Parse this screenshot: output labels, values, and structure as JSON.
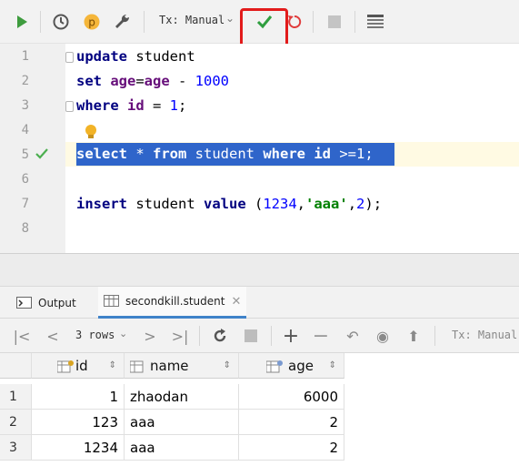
{
  "toolbar": {
    "tx_label": "Tx: Manual",
    "buttons": [
      "execute",
      "history",
      "profile",
      "settings",
      "commit",
      "rollback",
      "stop",
      "output-layout"
    ]
  },
  "editor": {
    "line_numbers": [
      "1",
      "2",
      "3",
      "4",
      "5",
      "6",
      "7",
      "8"
    ],
    "lines": [
      [
        {
          "t": "update",
          "c": "kw"
        },
        {
          "t": " student",
          "c": ""
        }
      ],
      [
        {
          "t": "set ",
          "c": "kw"
        },
        {
          "t": "age",
          "c": "col"
        },
        {
          "t": "=",
          "c": ""
        },
        {
          "t": "age",
          "c": "col"
        },
        {
          "t": " - ",
          "c": ""
        },
        {
          "t": "1000",
          "c": "num"
        }
      ],
      [
        {
          "t": "where ",
          "c": "kw"
        },
        {
          "t": "id",
          "c": "col"
        },
        {
          "t": " = ",
          "c": ""
        },
        {
          "t": "1",
          "c": "num"
        },
        {
          "t": ";",
          "c": ""
        }
      ],
      [],
      [
        {
          "t": "select",
          "c": "k"
        },
        {
          "t": " * ",
          "c": ""
        },
        {
          "t": "from",
          "c": "k"
        },
        {
          "t": " student ",
          "c": ""
        },
        {
          "t": "where",
          "c": "k"
        },
        {
          "t": " ",
          "c": ""
        },
        {
          "t": "id",
          "c": "k"
        },
        {
          "t": " >=1;",
          "c": ""
        }
      ],
      [],
      [
        {
          "t": "insert",
          "c": "kw"
        },
        {
          "t": " student ",
          "c": ""
        },
        {
          "t": "value",
          "c": "kw"
        },
        {
          "t": " (",
          "c": ""
        },
        {
          "t": "1234",
          "c": "num"
        },
        {
          "t": ",",
          "c": ""
        },
        {
          "t": "'aaa'",
          "c": "str"
        },
        {
          "t": ",",
          "c": ""
        },
        {
          "t": "2",
          "c": "num"
        },
        {
          "t": ");",
          "c": ""
        }
      ],
      []
    ],
    "selected_line": 5
  },
  "result_tabs": {
    "output_label": "Output",
    "table_label": "secondkill.student"
  },
  "result_toolbar": {
    "rows_label": "3 rows",
    "tx_label": "Tx: Manual"
  },
  "grid": {
    "columns": [
      "id",
      "name",
      "age"
    ],
    "rows": [
      {
        "num": "1",
        "id": "1",
        "name": "zhaodan",
        "age": "6000"
      },
      {
        "num": "2",
        "id": "123",
        "name": "aaa",
        "age": "2"
      },
      {
        "num": "3",
        "id": "1234",
        "name": "aaa",
        "age": "2"
      }
    ]
  },
  "colors": {
    "run_green": "#3e9c3e",
    "commit_green": "#2f9e3f",
    "highlight_red": "#e21b1b",
    "selection_blue": "#2f65ca"
  }
}
